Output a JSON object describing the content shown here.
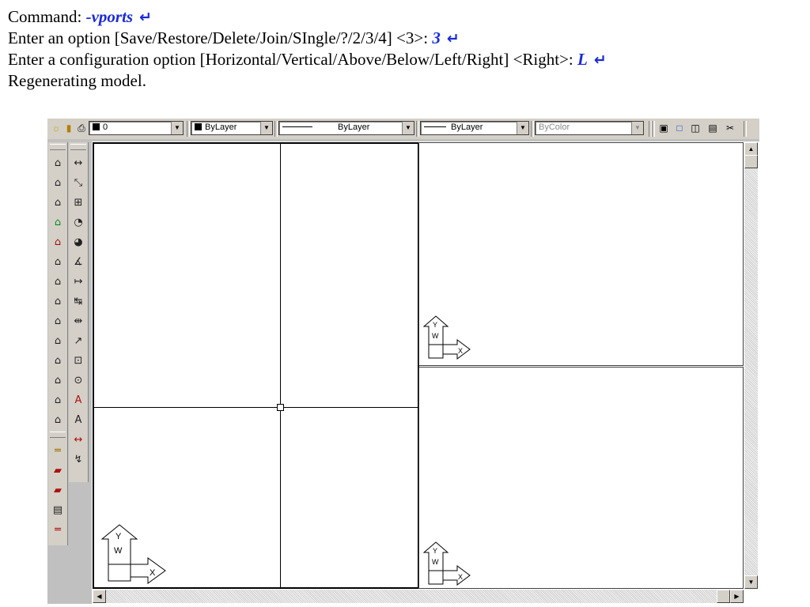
{
  "command": {
    "line1": {
      "prefix": "Command: ",
      "input": "-vports"
    },
    "line2": {
      "prefix": "Enter an option [Save/Restore/Delete/Join/SIngle/?/2/3/4] <3>: ",
      "input": "3"
    },
    "line3": {
      "prefix": "Enter a configuration option [Horizontal/Vertical/Above/Below/Left/Right] <Right>: ",
      "input": "L"
    },
    "line4": "Regenerating model.",
    "enter_glyph": "↵"
  },
  "toolbar": {
    "layer_value": "0",
    "color_value": "ByLayer",
    "linetype_value": "ByLayer",
    "lineweight_value": "ByLayer",
    "plotstyle_value": "ByColor"
  },
  "ucs": {
    "x": "X",
    "y": "Y",
    "w": "W"
  },
  "palette_left": [
    "⌂",
    "⌂",
    "⌂",
    "⌂",
    "⌂",
    "⌂",
    "⌂",
    "⌂",
    "⌂",
    "⌂",
    "⌂",
    "⌂",
    "⌂",
    "⌂",
    "═",
    "▰",
    "▰",
    "▤",
    "═"
  ],
  "palette_right": [
    "↔",
    "⤡",
    "⊞",
    "◔",
    "◕",
    "∡",
    "↦",
    "↹",
    "⇹",
    "↗",
    "⊡",
    "⊙",
    "A",
    "A",
    "↔",
    "↯"
  ]
}
